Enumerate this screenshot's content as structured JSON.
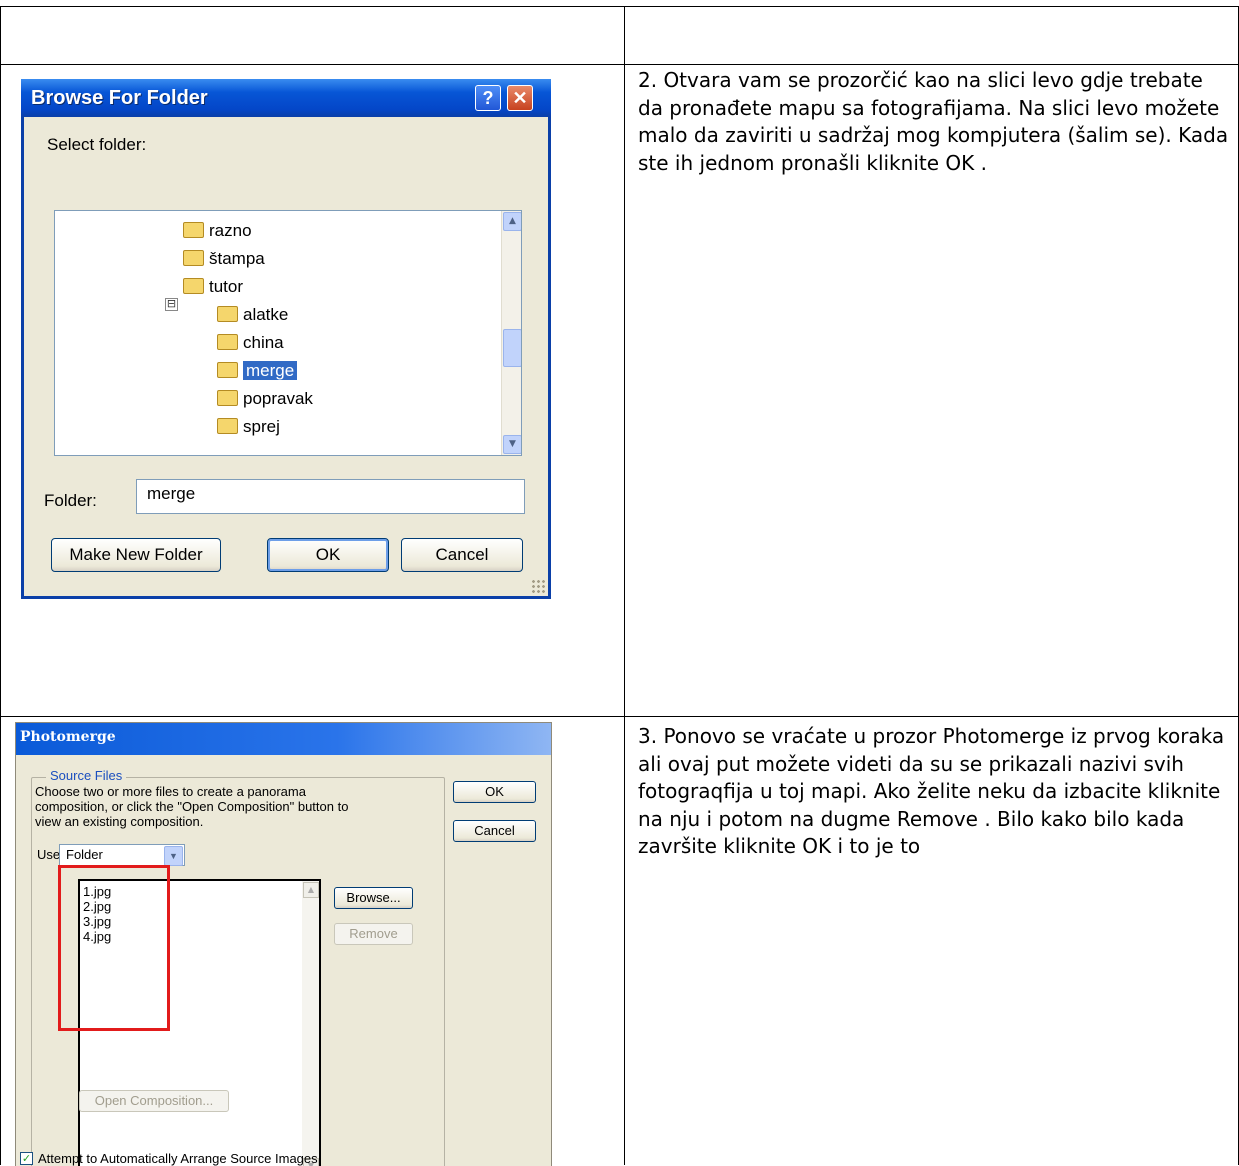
{
  "step2": {
    "description": "2. Otvara vam se prozorčić kao na slici levo gdje trebate da pronađete mapu sa fotografijama. Na slici levo možete malo da zaviriti u sadržaj mog kompjutera (šalim se). Kada ste ih jednom pronašli kliknite OK .",
    "dialog": {
      "title": "Browse For Folder",
      "help_glyph": "?",
      "close_glyph": "✕",
      "prompt": "Select folder:",
      "tree_items": [
        "razno",
        "štampa",
        "tutor",
        "alatke",
        "china",
        "merge",
        "popravak",
        "sprej"
      ],
      "selected_item": "merge",
      "expander_glyph": "⊟",
      "folder_label": "Folder:",
      "folder_value": "merge",
      "make_new_folder": "Make New Folder",
      "ok": "OK",
      "cancel": "Cancel"
    }
  },
  "step3": {
    "description": "3. Ponovo se vraćate u prozor Photomerge iz prvog koraka ali ovaj put možete videti da su se prikazali nazivi svih fotograqfija u toj mapi. Ako želite neku da izbacite kliknite na nju i potom na dugme Remove . Bilo kako bilo kada završite kliknite OK i to je to",
    "dialog": {
      "title": "Photomerge",
      "group_label": "Source Files",
      "instructions": [
        "Choose two or more files to create a panorama",
        "composition, or click the \"Open Composition\" button to",
        "view an existing composition."
      ],
      "use_label": "Use",
      "use_value": "Folder",
      "files": [
        "1.jpg",
        "2.jpg",
        "3.jpg",
        "4.jpg"
      ],
      "browse": "Browse...",
      "remove": "Remove",
      "open_composition": "Open Composition...",
      "ok": "OK",
      "cancel": "Cancel",
      "auto_arrange": "Attempt to Automatically Arrange Source Images",
      "auto_arrange_checked": true
    }
  },
  "colors": {
    "highlight": "#e21b1b",
    "selection": "#316ac5",
    "xp_title": "#0756d6"
  }
}
